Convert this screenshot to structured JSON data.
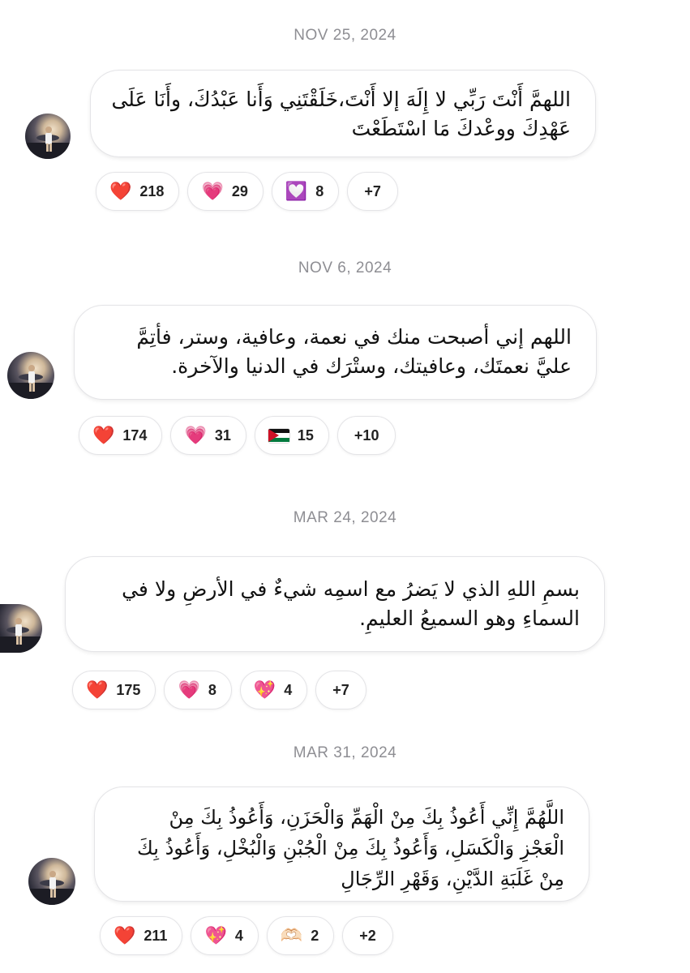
{
  "posts": [
    {
      "date": "NOV 25, 2024",
      "message": "اللهمَّ أَنْتَ رَبِّي لا إِلَهَ إلا أَنْتَ،خَلَقْتَنِي وَأَنا عَبْدُكَ، وأَنَا عَلَى\nعَهْدِكَ ووعْدكَ مَا اسْتَطَعْتَ",
      "reactions": [
        {
          "emoji": "❤️",
          "icon": "red-heart-icon",
          "count": "218"
        },
        {
          "emoji": "💗",
          "icon": "growing-heart-icon",
          "count": "29"
        },
        {
          "emoji": "💟",
          "icon": "heart-decoration-icon",
          "count": "8"
        }
      ],
      "more": "+7"
    },
    {
      "date": "NOV 6, 2024",
      "message": "اللهم إني أصبحت منك في نعمة، وعافية، وستر، فأتِمَّ\nعليَّ نعمتَك، وعافيتك، وستْرَك في الدنيا والآخرة.",
      "reactions": [
        {
          "emoji": "❤️",
          "icon": "red-heart-icon",
          "count": "174"
        },
        {
          "emoji": "💗",
          "icon": "growing-heart-icon",
          "count": "31"
        },
        {
          "emoji": "flag",
          "icon": "palestine-flag-icon",
          "count": "15"
        }
      ],
      "more": "+10"
    },
    {
      "date": "MAR 24, 2024",
      "message": "بسمِ اللهِ الذي لا يَضرُ مع اسمِه شيءٌ في الأرضِ ولا في\nالسماءِ وهو السميعُ العليمِ.",
      "reactions": [
        {
          "emoji": "❤️",
          "icon": "red-heart-icon",
          "count": "175"
        },
        {
          "emoji": "💗",
          "icon": "growing-heart-icon",
          "count": "8"
        },
        {
          "emoji": "💖",
          "icon": "sparkling-heart-icon",
          "count": "4"
        }
      ],
      "more": "+7"
    },
    {
      "date": "MAR 31, 2024",
      "message": "اللَّهُمَّ إِنِّي أَعُوذُ بِكَ مِنْ الْهَمِّ وَالْحَزَنِ، وَأَعُوذُ بِكَ مِنْ\nالْعَجْزِ وَالْكَسَلِ، وَأَعُوذُ بِكَ مِنْ الْجُبْنِ وَالْبُخْلِ، وَأَعُوذُ بِكَ\nمِنْ غَلَبَةِ الدَّيْنِ، وَقَهْرِ الرِّجَالِ",
      "reactions": [
        {
          "emoji": "❤️",
          "icon": "red-heart-icon",
          "count": "211"
        },
        {
          "emoji": "💖",
          "icon": "sparkling-heart-icon",
          "count": "4"
        },
        {
          "emoji": "🫶🏻",
          "icon": "heart-hands-icon",
          "count": "2"
        }
      ],
      "more": "+2"
    }
  ]
}
